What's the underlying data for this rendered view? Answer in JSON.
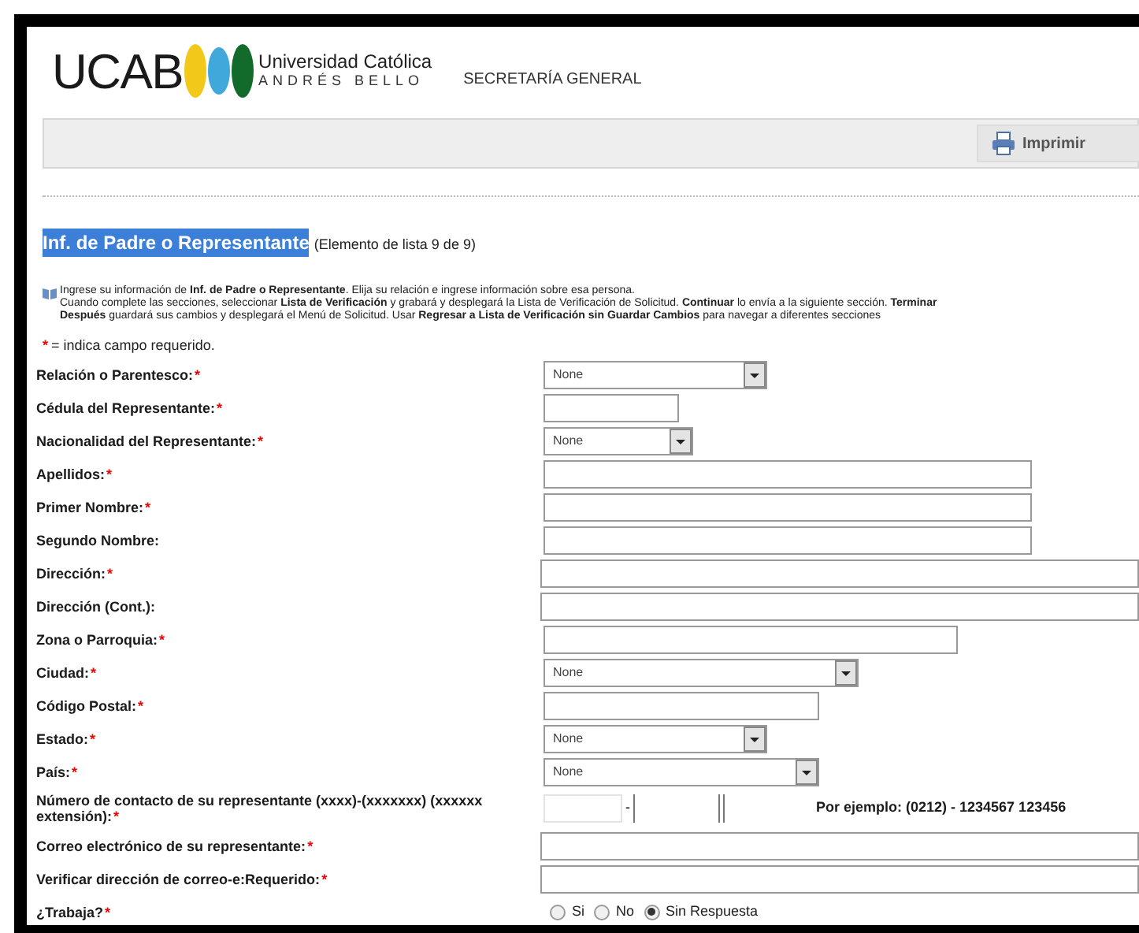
{
  "header": {
    "logo_text": "UCAB",
    "university_line1": "Universidad Católica",
    "university_line2": "ANDRÉS BELLO",
    "department": "SECRETARÍA GENERAL"
  },
  "toolbar": {
    "print_button": "Imprimir"
  },
  "heading": {
    "title": "Inf. de Padre o Representante",
    "title_selected": true,
    "subtitle": "(Elemento de lista 9 de 9)"
  },
  "instructions": [
    "Ingrese su información de **Inf. de Padre o Representante**. Elija su relación e ingrese información sobre esa persona.",
    "Cuando complete las secciones, seleccionar **Lista de Verificación** y grabará y desplegará la Lista de Verificación de Solicitud. **Continuar** lo envía a la siguiente sección. **Terminar**",
    "**Después** guardará sus cambios y desplegará el Menú de Solicitud. Usar **Regresar a Lista de Verificación sin Guardar Cambios** para navegar a diferentes secciones"
  ],
  "required_note": {
    "mark": "*",
    "text": "= indica campo requerido."
  },
  "fields": [
    {
      "kind": "select",
      "label": "Relación o Parentesco:",
      "mark": "*",
      "value": "None"
    },
    {
      "kind": "text",
      "label": "Cédula del Representante:",
      "mark": "*"
    },
    {
      "kind": "select",
      "label": "Nacionalidad del Representante:",
      "mark": "*",
      "value": "None"
    },
    {
      "kind": "text",
      "label": "Apellidos:",
      "mark": "*"
    },
    {
      "kind": "text",
      "label": "Primer Nombre:",
      "mark": "*"
    },
    {
      "kind": "text",
      "label": "Segundo Nombre:"
    },
    {
      "kind": "text",
      "label": "Dirección:",
      "mark": "*"
    },
    {
      "kind": "text",
      "label": "Dirección (Cont.):"
    },
    {
      "kind": "text",
      "label": "Zona o Parroquia:",
      "mark": "*"
    },
    {
      "kind": "select",
      "label": "Ciudad:",
      "mark": "*",
      "value": "None"
    },
    {
      "kind": "text",
      "label": "Código Postal:",
      "mark": "*"
    },
    {
      "kind": "select",
      "label": "Estado:",
      "mark": "*",
      "value": "None"
    },
    {
      "kind": "select",
      "label": "País:",
      "mark": "*",
      "value": "None"
    },
    {
      "kind": "phone",
      "label": "Número de contacto de su representante (xxxx)-(xxxxxxx) (xxxxxx extensión):",
      "mark": "*",
      "separator": "-",
      "example": "Por ejemplo: (0212) - 1234567 123456"
    },
    {
      "kind": "text",
      "label": "Correo electrónico de su representante:",
      "mark": "*"
    },
    {
      "kind": "text",
      "label": "Verificar dirección de correo-e:Requerido:",
      "mark": "*"
    },
    {
      "kind": "radio",
      "label": "¿Trabaja?",
      "mark": "*",
      "options": [
        {
          "label": "Si",
          "selected": false
        },
        {
          "label": "No",
          "selected": false
        },
        {
          "label": "Sin Respuesta",
          "selected": true
        }
      ]
    }
  ]
}
